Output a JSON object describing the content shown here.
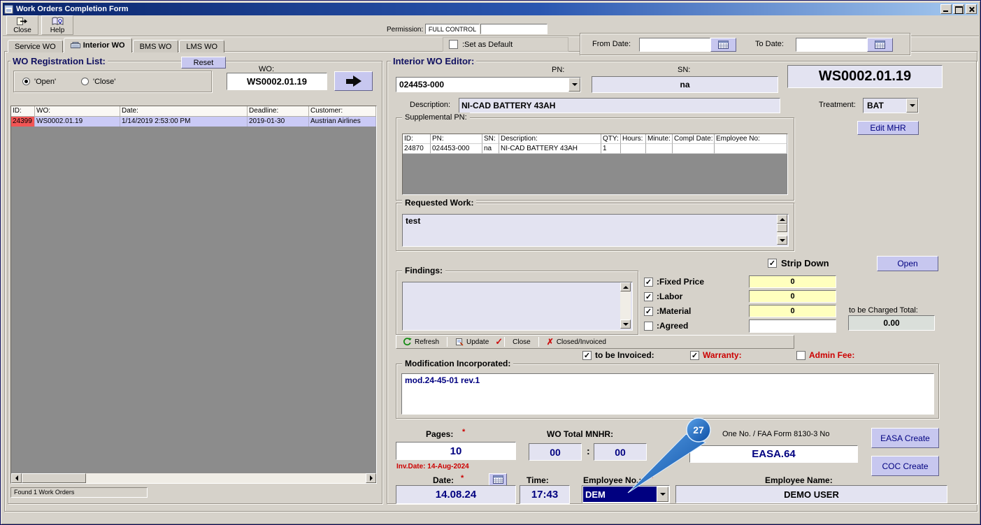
{
  "window": {
    "title": "Work Orders Completion Form"
  },
  "toolbar": {
    "close_label": "Close",
    "help_label": "Help",
    "permission_label": "Permission:",
    "permission_value": "FULL CONTROL",
    "permission_extra": ""
  },
  "tabs": [
    {
      "label": "Service WO",
      "active": false
    },
    {
      "label": "Interior WO",
      "active": true
    },
    {
      "label": "BMS WO",
      "active": false
    },
    {
      "label": "LMS WO",
      "active": false
    }
  ],
  "top_filters": {
    "set_as_default_label": ":Set as Default",
    "set_as_default_checked": false,
    "from_date_label": "From Date:",
    "from_date_value": "",
    "to_date_label": "To Date:",
    "to_date_value": ""
  },
  "registration": {
    "title": "WO Registration List:",
    "reset_label": "Reset",
    "radio_open_label": "'Open'",
    "radio_close_label": "'Close'",
    "radio_selected": "open",
    "wo_label": "WO:",
    "wo_value": "WS0002.01.19",
    "columns": [
      "ID:",
      "WO:",
      "Date:",
      "Deadline:",
      "Customer:"
    ],
    "rows": [
      [
        "24399",
        "WS0002.01.19",
        "1/14/2019 2:53:00 PM",
        "2019-01-30",
        "Austrian Airlines"
      ]
    ],
    "status_text": "Found 1 Work Orders"
  },
  "editor": {
    "title": "Interior WO Editor:",
    "pn_label": "PN:",
    "pn_value": "024453-000",
    "sn_label": "SN:",
    "sn_value": "na",
    "wo_display": "WS0002.01.19",
    "description_label": "Description:",
    "description_value": "NI-CAD BATTERY 43AH",
    "treatment_label": "Treatment:",
    "treatment_value": "BAT",
    "edit_mhr_label": "Edit MHR",
    "supplemental": {
      "title": "Supplemental PN:",
      "columns": [
        "ID:",
        "PN:",
        "SN:",
        "Description:",
        "QTY:",
        "Hours:",
        "Minute:",
        "Compl Date:",
        "Employee No:"
      ],
      "rows": [
        [
          "24870",
          "024453-000",
          "na",
          "NI-CAD BATTERY 43AH",
          "1",
          "",
          "",
          "",
          ""
        ]
      ]
    },
    "requested_work": {
      "title": "Requested Work:",
      "value": "test"
    },
    "strip_down": {
      "label": "Strip Down",
      "checked": true
    },
    "open_button_label": "Open",
    "findings": {
      "title": "Findings:",
      "value": ""
    },
    "pricing": {
      "items": [
        {
          "label": ":Fixed Price",
          "checked": true,
          "value": "0"
        },
        {
          "label": ":Labor",
          "checked": true,
          "value": "0"
        },
        {
          "label": ":Material",
          "checked": true,
          "value": "0"
        },
        {
          "label": ":Agreed",
          "checked": false,
          "value": ""
        }
      ],
      "charged_total_label": "to be Charged Total:",
      "charged_total_value": "0.00"
    },
    "actions": {
      "refresh_label": "Refresh",
      "update_label": "Update",
      "close_label": "Close",
      "closed_invoiced_label": "Closed/Invoiced"
    },
    "flags": [
      {
        "label": "to be Invoiced:",
        "checked": true
      },
      {
        "label": "Warranty:",
        "checked": true
      },
      {
        "label": "Admin Fee:",
        "checked": false
      }
    ],
    "modification": {
      "title": "Modification Incorporated:",
      "value": "mod.24-45-01 rev.1"
    },
    "pages_label": "Pages:",
    "pages_value": "10",
    "mnhr_label": "WO Total MNHR:",
    "mnhr_hours": "00",
    "mnhr_separator": ":",
    "mnhr_minutes": "00",
    "form_no_label": "One No. / FAA Form 8130-3 No",
    "form_no_value": "EASA.64",
    "easa_create_label": "EASA Create",
    "coc_create_label": "COC Create",
    "inv_date_text": "Inv.Date: 14-Aug-2024",
    "date_label": "Date:",
    "date_value": "14.08.24",
    "time_label": "Time:",
    "time_value": "17:43",
    "employee_no_label": "Employee No.:",
    "employee_no_value": "DEM",
    "employee_name_label": "Employee Name:",
    "employee_name_value": "DEMO USER",
    "required_marker": "*"
  },
  "callout": {
    "step_number": "27"
  },
  "colors": {
    "accent_button": "#c7c7ef",
    "field_bg": "#e3e3f1",
    "highlight_yellow": "#ffffbe",
    "selected_row": "#cacaf6",
    "id_cell_red": "#f25555",
    "navy_text": "#000080",
    "label_red": "#cc0000",
    "title_gradient_start": "#0a246a",
    "title_gradient_end": "#a6caf0"
  }
}
